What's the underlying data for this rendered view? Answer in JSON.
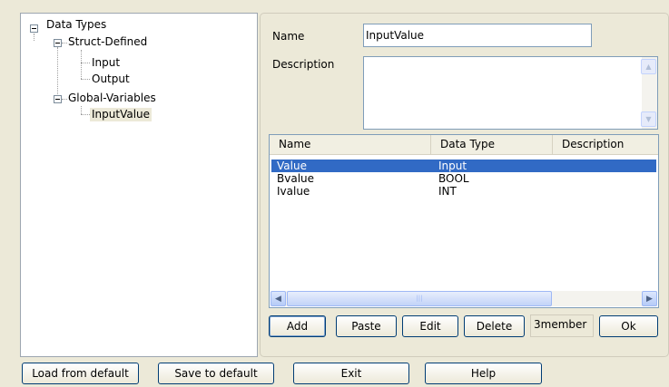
{
  "tree": {
    "root": "Data Types",
    "struct_defined": "Struct-Defined",
    "input": "Input",
    "output": "Output",
    "global_variables": "Global-Variables",
    "input_value": "InputValue"
  },
  "form": {
    "name_label": "Name",
    "name_value": "InputValue",
    "description_label": "Description",
    "description_value": ""
  },
  "list": {
    "columns": [
      "Name",
      "Data Type",
      "Description"
    ],
    "rows": [
      {
        "name": "Value",
        "type": "Input",
        "description": ""
      },
      {
        "name": "Bvalue",
        "type": "BOOL",
        "description": ""
      },
      {
        "name": "Ivalue",
        "type": "INT",
        "description": ""
      }
    ],
    "selected_index": 0
  },
  "actions": {
    "add": "Add",
    "paste": "Paste",
    "edit": "Edit",
    "delete": "Delete",
    "member_count": "3member",
    "ok": "Ok"
  },
  "footer": {
    "load_default": "Load from default",
    "save_default": "Save to default",
    "exit": "Exit",
    "help": "Help"
  },
  "icons": {
    "expander": "minus-box-icon",
    "scroll_up": "arrow-up-icon",
    "scroll_down": "arrow-down-icon",
    "scroll_left": "arrow-left-icon",
    "scroll_right": "arrow-right-icon"
  },
  "colors": {
    "selection": "#316ac5",
    "window": "#ece9d8",
    "border": "#7f9db9"
  }
}
